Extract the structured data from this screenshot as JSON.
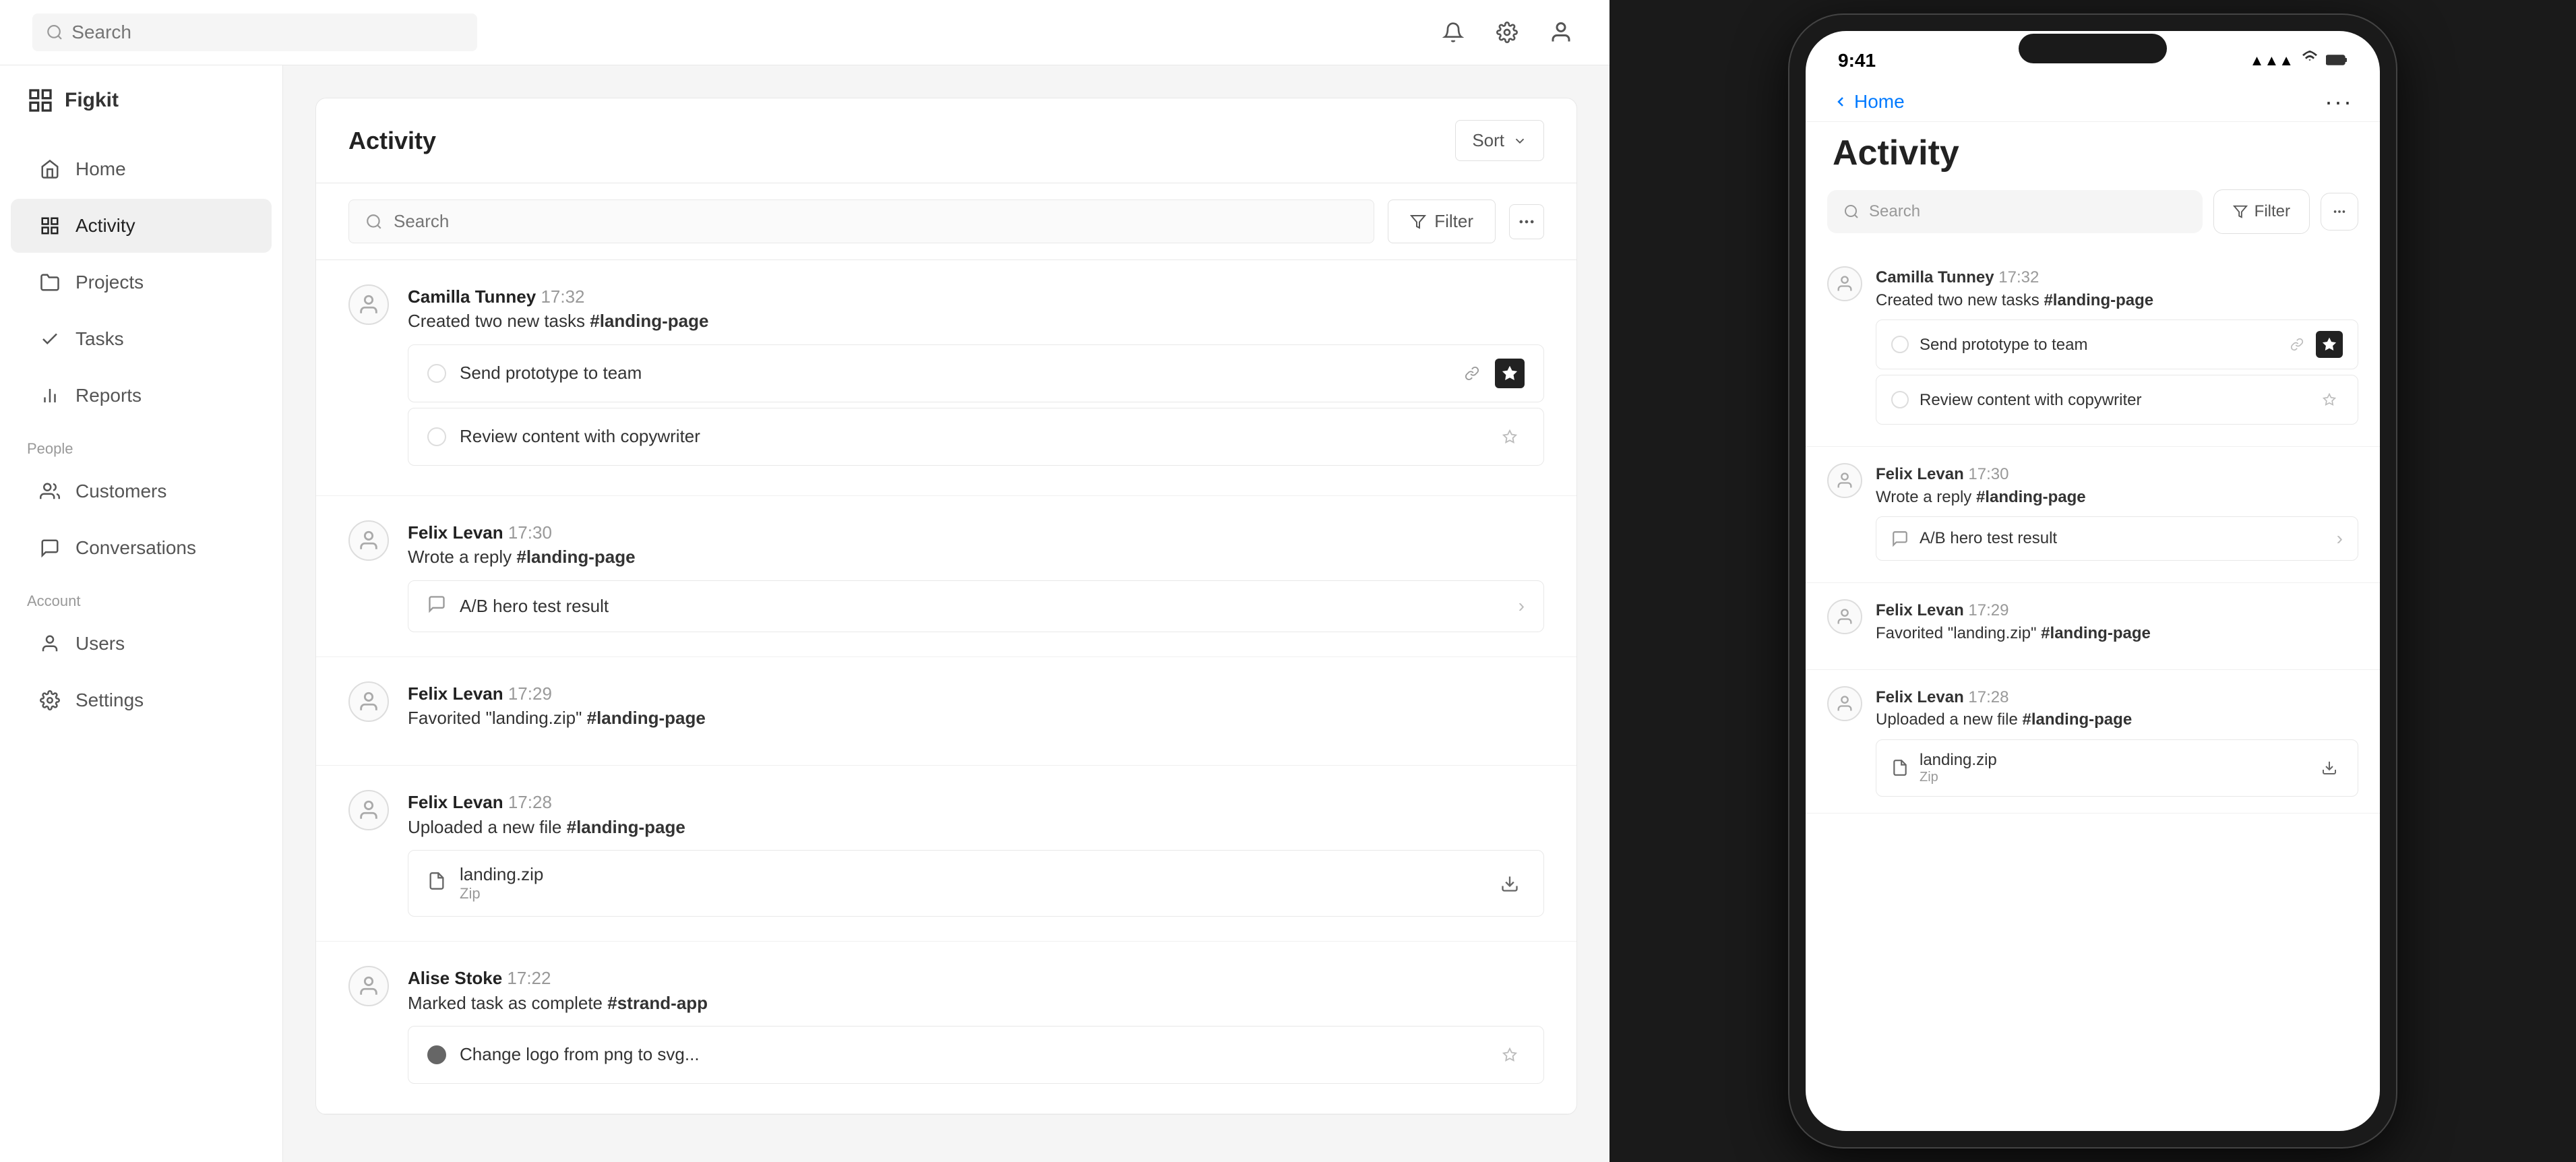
{
  "app": {
    "name": "Figkit",
    "logo_icon": "grid-icon"
  },
  "topbar": {
    "search_placeholder": "Search",
    "notification_icon": "bell-icon",
    "settings_icon": "gear-icon",
    "profile_icon": "user-circle-icon"
  },
  "sidebar": {
    "nav_items": [
      {
        "id": "home",
        "label": "Home",
        "icon": "home-icon",
        "active": false
      },
      {
        "id": "activity",
        "label": "Activity",
        "icon": "activity-icon",
        "active": true
      },
      {
        "id": "projects",
        "label": "Projects",
        "icon": "folder-icon",
        "active": false
      },
      {
        "id": "tasks",
        "label": "Tasks",
        "icon": "check-icon",
        "active": false
      }
    ],
    "people_label": "People",
    "people_items": [
      {
        "id": "customers",
        "label": "Customers",
        "icon": "users-icon"
      },
      {
        "id": "conversations",
        "label": "Conversations",
        "icon": "chat-icon"
      }
    ],
    "account_label": "Account",
    "account_items": [
      {
        "id": "users",
        "label": "Users",
        "icon": "user-icon"
      },
      {
        "id": "settings",
        "label": "Settings",
        "icon": "settings-icon"
      }
    ],
    "reports_item": {
      "id": "reports",
      "label": "Reports",
      "icon": "bar-chart-icon"
    }
  },
  "activity": {
    "title": "Activity",
    "sort_label": "Sort",
    "search_placeholder": "Search",
    "filter_label": "Filter",
    "items": [
      {
        "id": "item1",
        "user": "Camilla Tunney",
        "time": "17:32",
        "action": "Created two new tasks",
        "tag": "#landing-page",
        "tasks": [
          {
            "id": "t1",
            "label": "Send prototype to team",
            "checked": false,
            "starred": true,
            "linked": true
          },
          {
            "id": "t2",
            "label": "Review content with copywriter",
            "checked": false,
            "starred": false,
            "linked": false
          }
        ]
      },
      {
        "id": "item2",
        "user": "Felix Levan",
        "time": "17:30",
        "action": "Wrote a reply",
        "tag": "#landing-page",
        "reply": "A/B hero test result"
      },
      {
        "id": "item3",
        "user": "Felix Levan",
        "time": "17:29",
        "action": "Favorited \"landing.zip\"",
        "tag": "#landing-page"
      },
      {
        "id": "item4",
        "user": "Felix Levan",
        "time": "17:28",
        "action": "Uploaded a new file",
        "tag": "#landing-page",
        "file": {
          "name": "landing.zip",
          "type": "Zip"
        }
      },
      {
        "id": "item5",
        "user": "Alise Stoke",
        "time": "17:22",
        "action": "Marked task as complete",
        "tag": "#strand-app",
        "tasks": [
          {
            "id": "t3",
            "label": "Change logo from png to svg...",
            "checked": true,
            "starred": false
          }
        ]
      }
    ]
  },
  "mobile": {
    "time": "9:41",
    "back_label": "Home",
    "more_label": "···",
    "title": "Activity",
    "search_placeholder": "Search",
    "filter_label": "Filter",
    "items": [
      {
        "id": "m1",
        "user": "Camilla Tunney",
        "time": "17:32",
        "action": "Created two new tasks",
        "tag": "#landing-page",
        "tasks": [
          {
            "id": "mt1",
            "label": "Send prototype to team",
            "checked": false,
            "starred": true,
            "linked": true
          },
          {
            "id": "mt2",
            "label": "Review content with copywriter",
            "checked": false,
            "starred": false
          }
        ]
      },
      {
        "id": "m2",
        "user": "Felix Levan",
        "time": "17:30",
        "action": "Wrote a reply",
        "tag": "#landing-page",
        "reply": "A/B hero test result"
      },
      {
        "id": "m3",
        "user": "Felix Levan",
        "time": "17:29",
        "action": "Favorited \"landing.zip\"",
        "tag": "#landing-page"
      },
      {
        "id": "m4",
        "user": "Felix Levan",
        "time": "17:28",
        "action": "Uploaded a new file",
        "tag": "#landing-page",
        "file": {
          "name": "landing.zip",
          "type": "Zip"
        }
      }
    ]
  }
}
